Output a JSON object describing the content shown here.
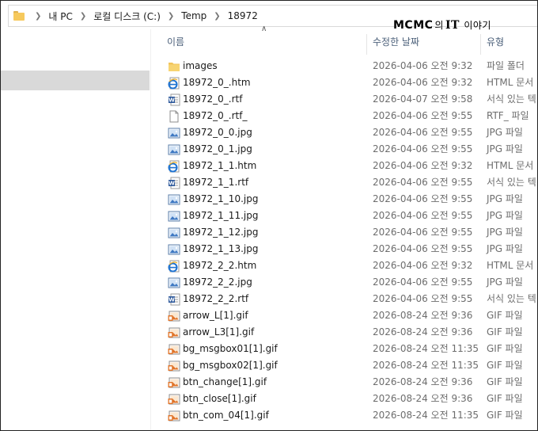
{
  "breadcrumb": {
    "items": [
      "내 PC",
      "로컬 디스크 (C:)",
      "Temp",
      "18972"
    ]
  },
  "watermark": {
    "brand": "MCMC",
    "particle": "의",
    "it": "IT",
    "tail": "이야기"
  },
  "columns": {
    "name": "이름",
    "date": "수정한 날짜",
    "type": "유형"
  },
  "files": [
    {
      "name": "images",
      "date": "2026-04-06 오전 9:32",
      "type": "파일 폴더",
      "icon": "folder-icon"
    },
    {
      "name": "18972_0_.htm",
      "date": "2026-04-06 오전 9:32",
      "type": "HTML 문서",
      "icon": "html-icon"
    },
    {
      "name": "18972_0_.rtf",
      "date": "2026-04-07 오전 9:58",
      "type": "서식 있는 텍",
      "icon": "word-icon"
    },
    {
      "name": "18972_0_.rtf_",
      "date": "2026-04-06 오전 9:55",
      "type": "RTF_ 파일",
      "icon": "blank-file-icon"
    },
    {
      "name": "18972_0_0.jpg",
      "date": "2026-04-06 오전 9:55",
      "type": "JPG 파일",
      "icon": "image-icon"
    },
    {
      "name": "18972_0_1.jpg",
      "date": "2026-04-06 오전 9:55",
      "type": "JPG 파일",
      "icon": "image-icon"
    },
    {
      "name": "18972_1_1.htm",
      "date": "2026-04-06 오전 9:32",
      "type": "HTML 문서",
      "icon": "html-icon"
    },
    {
      "name": "18972_1_1.rtf",
      "date": "2026-04-06 오전 9:55",
      "type": "서식 있는 텍",
      "icon": "word-icon"
    },
    {
      "name": "18972_1_10.jpg",
      "date": "2026-04-06 오전 9:55",
      "type": "JPG 파일",
      "icon": "image-icon"
    },
    {
      "name": "18972_1_11.jpg",
      "date": "2026-04-06 오전 9:55",
      "type": "JPG 파일",
      "icon": "image-icon"
    },
    {
      "name": "18972_1_12.jpg",
      "date": "2026-04-06 오전 9:55",
      "type": "JPG 파일",
      "icon": "image-icon"
    },
    {
      "name": "18972_1_13.jpg",
      "date": "2026-04-06 오전 9:55",
      "type": "JPG 파일",
      "icon": "image-icon"
    },
    {
      "name": "18972_2_2.htm",
      "date": "2026-04-06 오전 9:32",
      "type": "HTML 문서",
      "icon": "html-icon"
    },
    {
      "name": "18972_2_2.jpg",
      "date": "2026-04-06 오전 9:55",
      "type": "JPG 파일",
      "icon": "image-icon"
    },
    {
      "name": "18972_2_2.rtf",
      "date": "2026-04-06 오전 9:55",
      "type": "서식 있는 텍",
      "icon": "word-icon"
    },
    {
      "name": "arrow_L[1].gif",
      "date": "2026-08-24 오전 9:36",
      "type": "GIF 파일",
      "icon": "gif-icon"
    },
    {
      "name": "arrow_L3[1].gif",
      "date": "2026-08-24 오전 9:36",
      "type": "GIF 파일",
      "icon": "gif-icon"
    },
    {
      "name": "bg_msgbox01[1].gif",
      "date": "2026-08-24 오전 11:35",
      "type": "GIF 파일",
      "icon": "gif-icon"
    },
    {
      "name": "bg_msgbox02[1].gif",
      "date": "2026-08-24 오전 11:35",
      "type": "GIF 파일",
      "icon": "gif-icon"
    },
    {
      "name": "btn_change[1].gif",
      "date": "2026-08-24 오전 9:36",
      "type": "GIF 파일",
      "icon": "gif-icon"
    },
    {
      "name": "btn_close[1].gif",
      "date": "2026-08-24 오전 9:36",
      "type": "GIF 파일",
      "icon": "gif-icon"
    },
    {
      "name": "btn_com_04[1].gif",
      "date": "2026-08-24 오전 11:35",
      "type": "GIF 파일",
      "icon": "gif-icon"
    }
  ]
}
